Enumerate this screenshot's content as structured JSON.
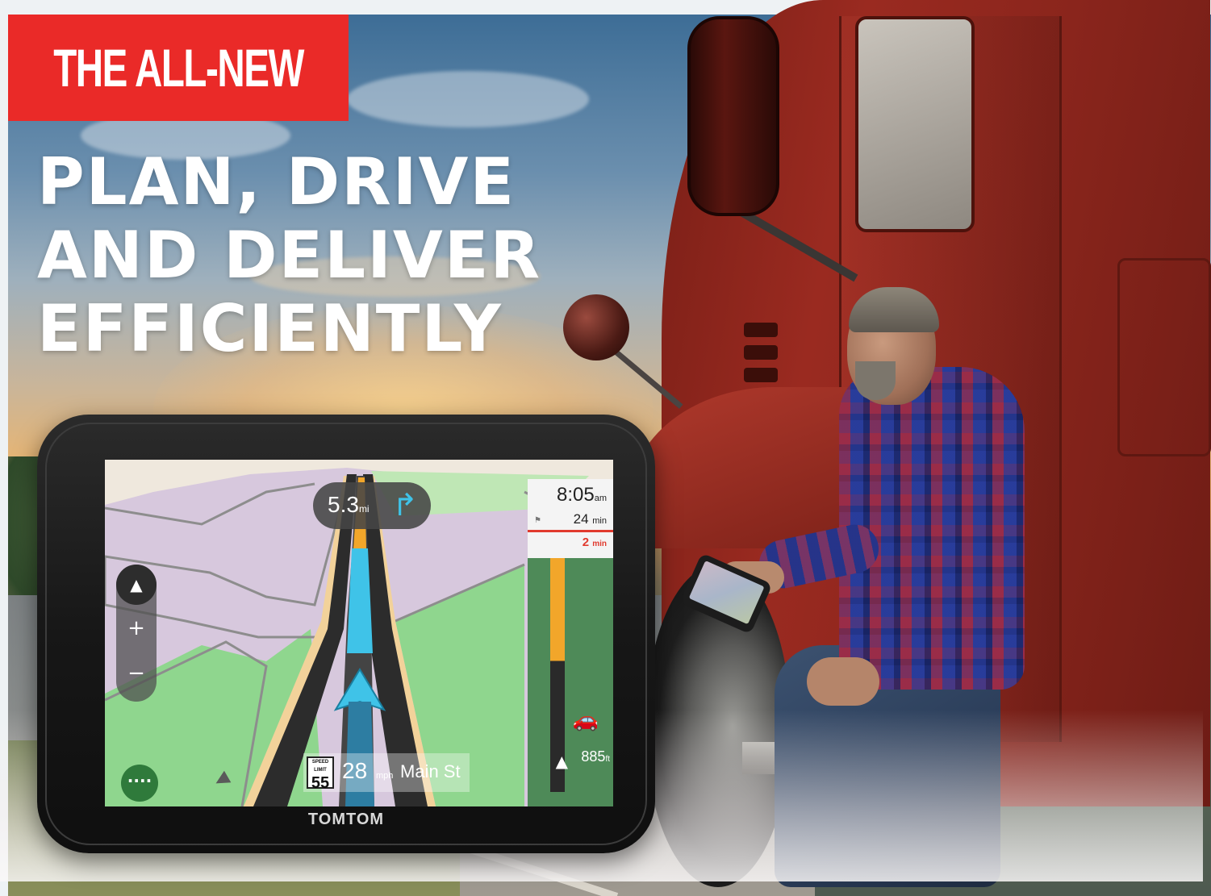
{
  "hero": {
    "badge_text": "THE ALL-NEW",
    "headline": [
      "PLAN, DRIVE",
      "AND DELIVER",
      "EFFICIENTLY"
    ]
  },
  "device": {
    "brand": "TOMTOM",
    "instruction": {
      "distance": "5.3",
      "distance_unit": "mi"
    },
    "eta": {
      "arrival_time": "8:05",
      "arrival_suffix": "am",
      "duration": "24",
      "duration_unit": "min",
      "delay": "2",
      "delay_unit": "min"
    },
    "speed": {
      "limit_label": "SPEED LIMIT",
      "limit": "55",
      "current": "28",
      "unit": "mph"
    },
    "street": "Main St",
    "next_distance": "885",
    "next_distance_unit": "ft",
    "menu_label": "····"
  },
  "colors": {
    "badge": "#ea2a28",
    "route": "#3fc3e8",
    "panel": "#4e8a58",
    "truck": "#8a251c"
  }
}
